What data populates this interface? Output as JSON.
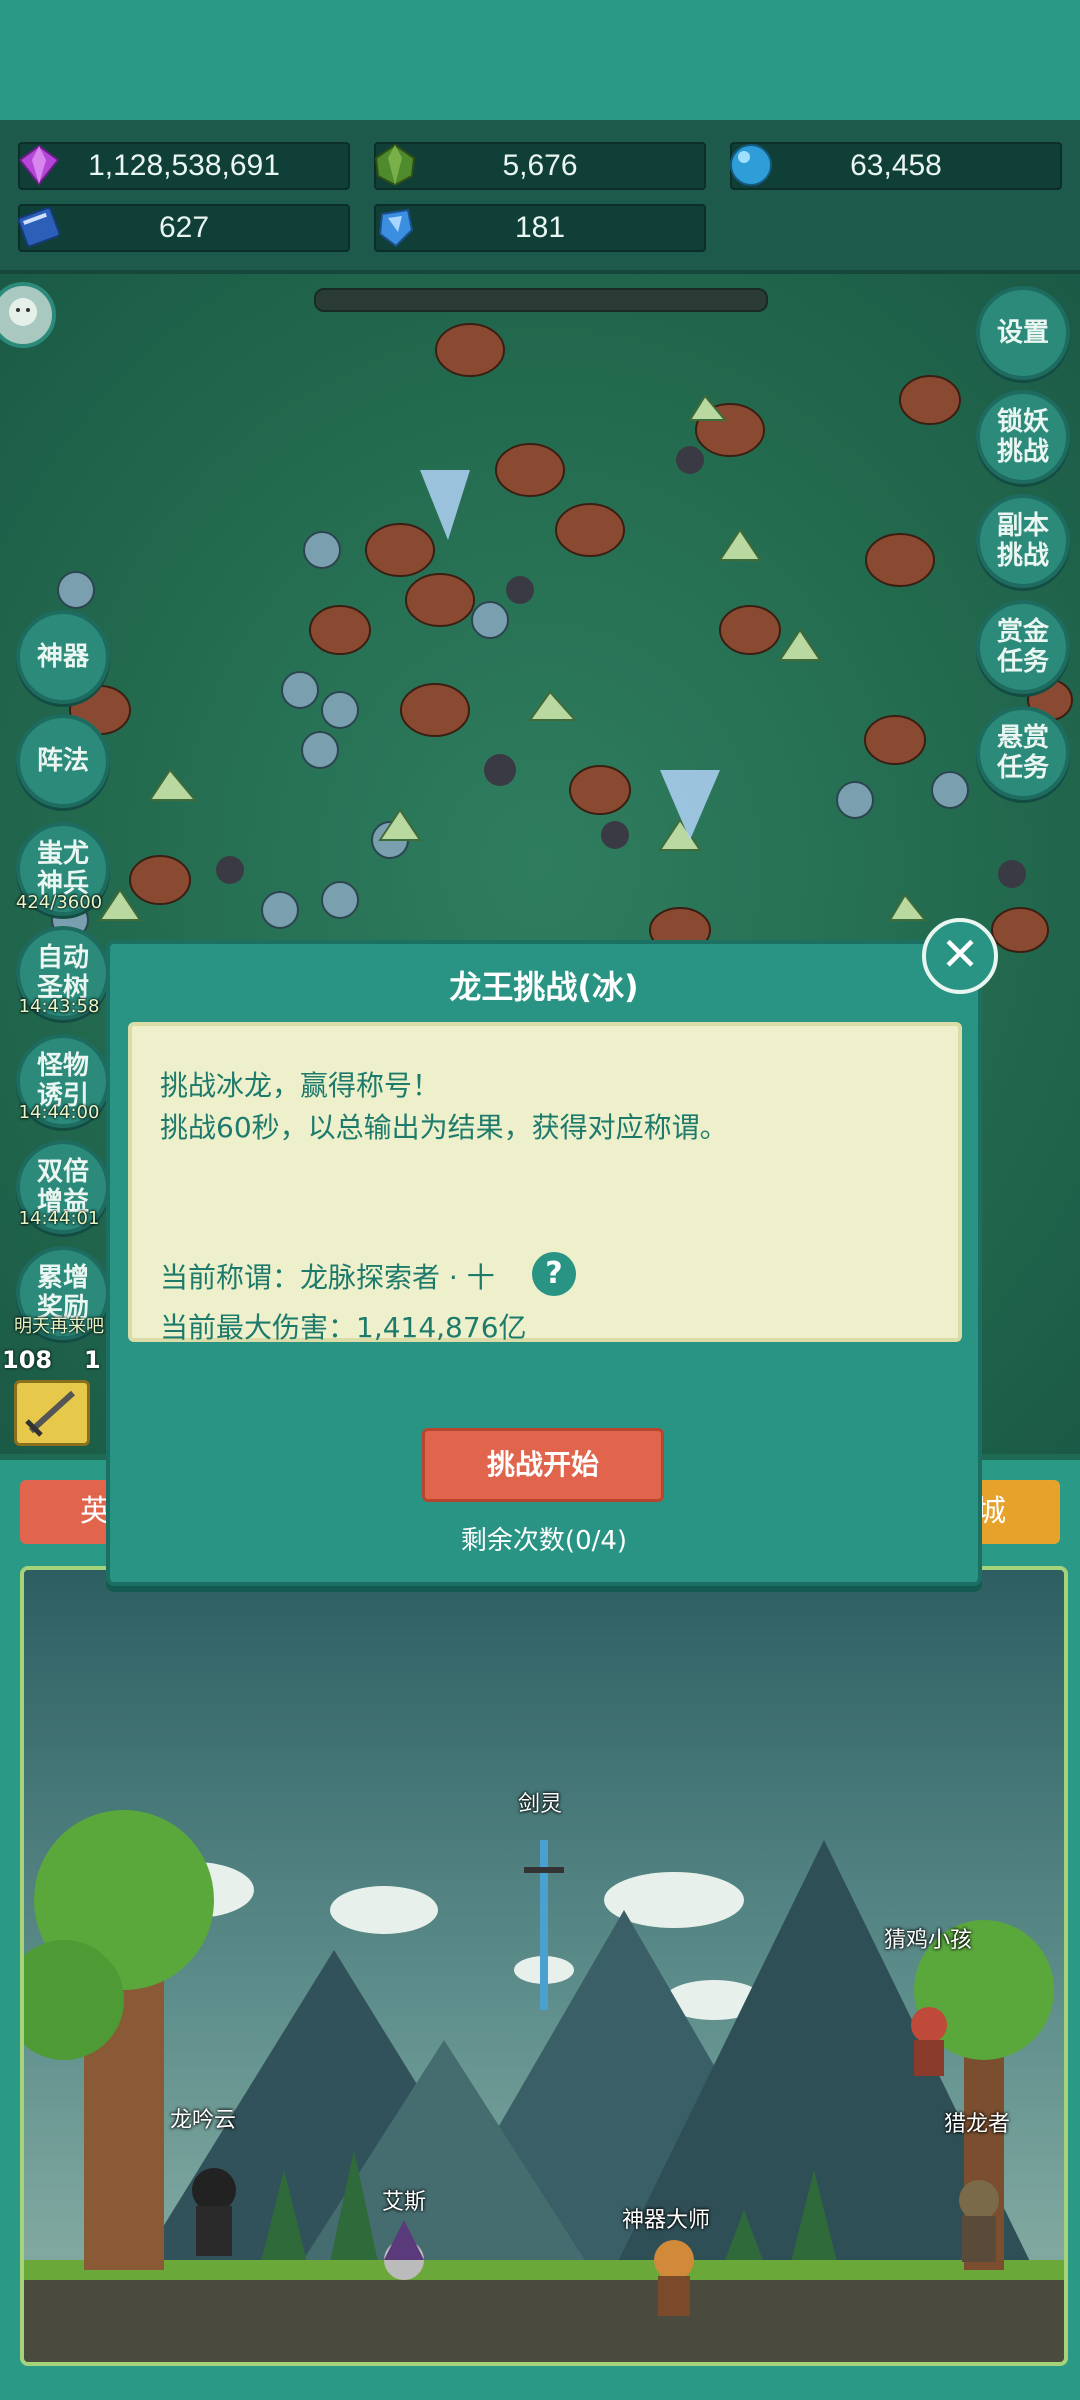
{
  "resources": [
    {
      "icon": "purple-gem-icon",
      "value": "1,128,538,691"
    },
    {
      "icon": "green-crystal-icon",
      "value": "5,676"
    },
    {
      "icon": "blue-orb-icon",
      "value": "63,458"
    },
    {
      "icon": "blue-book-icon",
      "value": "627"
    },
    {
      "icon": "blue-shard-icon",
      "value": "181"
    }
  ],
  "right_buttons": [
    {
      "label": "设置"
    },
    {
      "label": "锁妖\n挑战"
    },
    {
      "label": "副本\n挑战"
    },
    {
      "label": "赏金\n任务"
    },
    {
      "label": "悬赏\n任务"
    }
  ],
  "left_buttons": [
    {
      "label": "神器",
      "timer": ""
    },
    {
      "label": "阵法",
      "timer": ""
    },
    {
      "label": "蚩尤\n神兵",
      "timer": "424/3600"
    },
    {
      "label": "自动\n圣树",
      "timer": "14:43:58"
    },
    {
      "label": "怪物\n诱引",
      "timer": "14:44:00"
    },
    {
      "label": "双倍\n增益",
      "timer": "14:44:01"
    },
    {
      "label": "累增\n奖励",
      "timer": "明天再来吧"
    }
  ],
  "level_badge": {
    "value": "108",
    "value2": "1"
  },
  "modal": {
    "title": "龙王挑战(冰)",
    "line1": "挑战冰龙，赢得称号！",
    "line2": "挑战60秒，以总输出为结果，获得对应称谓。",
    "current_title_label": "当前称谓：龙脉探索者 · 十",
    "max_damage_label": "当前最大伤害：1,414,876亿",
    "start_button": "挑战开始",
    "remaining": "剩余次数(0/4)",
    "help": "?",
    "close": "✕"
  },
  "tabs": {
    "left": "英",
    "right": "城"
  },
  "characters": [
    {
      "name": "剑灵"
    },
    {
      "name": "猜鸡小孩"
    },
    {
      "name": "龙吟云"
    },
    {
      "name": "猎龙者"
    },
    {
      "name": "艾斯"
    },
    {
      "name": "神器大师"
    }
  ],
  "colors": {
    "accent": "#2a9484",
    "start": "#e0654c",
    "panel": "#eef0cc",
    "text": "#1e7b6c"
  }
}
